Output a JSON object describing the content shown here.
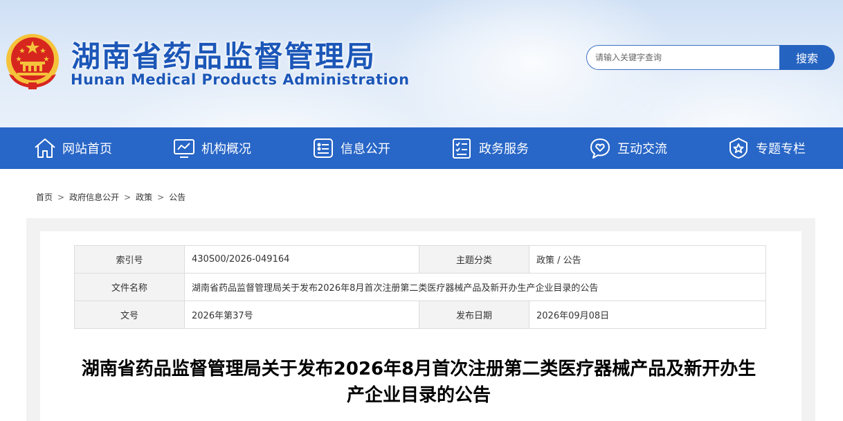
{
  "header": {
    "title_cn": "湖南省药品监督管理局",
    "title_en": "Hunan Medical Products Administration",
    "search_placeholder": "请输入关键字查询",
    "search_button": "搜索"
  },
  "nav": {
    "items": [
      {
        "label": "网站首页",
        "icon": "home-icon"
      },
      {
        "label": "机构概况",
        "icon": "monitor-chart-icon"
      },
      {
        "label": "信息公开",
        "icon": "document-list-icon"
      },
      {
        "label": "政务服务",
        "icon": "checklist-icon"
      },
      {
        "label": "互动交流",
        "icon": "chat-heart-icon"
      },
      {
        "label": "专题专栏",
        "icon": "badge-star-icon"
      }
    ]
  },
  "breadcrumb": [
    "首页",
    "政府信息公开",
    "政策",
    "公告"
  ],
  "breadcrumb_sep": ">",
  "meta": {
    "index_label": "索引号",
    "index_value": "430S00/2026-049164",
    "category_label": "主题分类",
    "category_value": "政策 / 公告",
    "filename_label": "文件名称",
    "filename_value": "湖南省药品监督管理局关于发布2026年8月首次注册第二类医疗器械产品及新开办生产企业目录的公告",
    "docno_label": "文号",
    "docno_value": "2026年第37号",
    "date_label": "发布日期",
    "date_value": "2026年09月08日"
  },
  "article": {
    "title_line1": "湖南省药品监督管理局关于发布2026年8月首次注册第二类医疗器械产品及新开办生",
    "title_line2": "产企业目录的公告"
  },
  "colors": {
    "brand_blue": "#2866c7",
    "title_blue": "#1c57b8",
    "emblem_red": "#d7261e",
    "emblem_gold": "#f5c33b"
  }
}
